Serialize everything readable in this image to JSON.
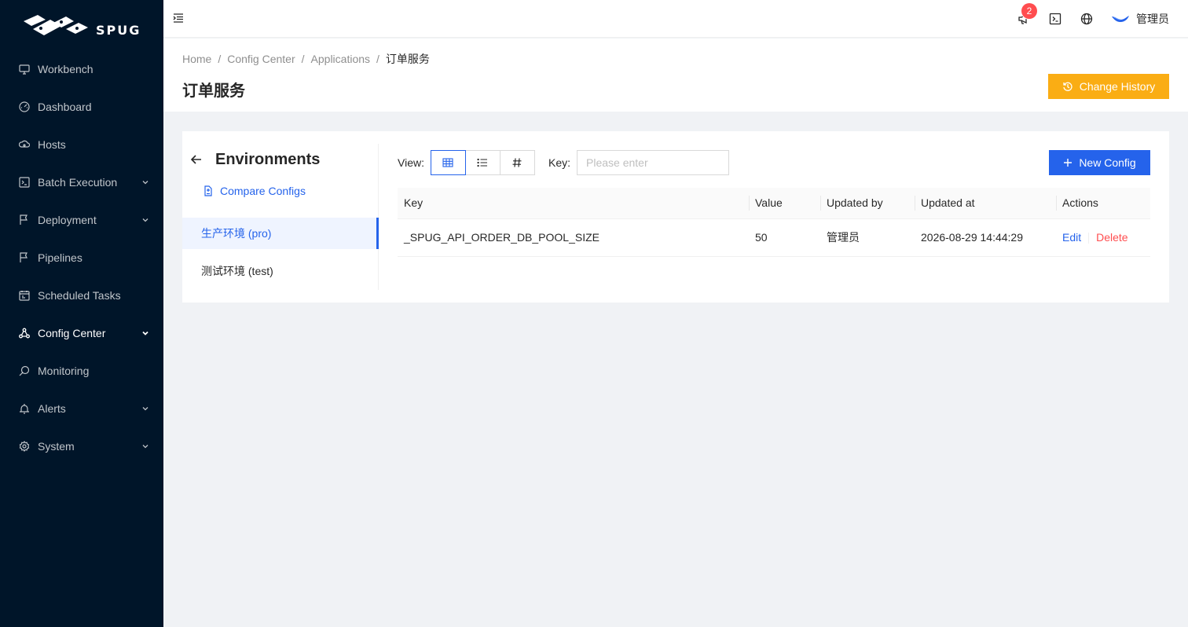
{
  "app": {
    "logo_text": "SPUG"
  },
  "sidebar": {
    "items": [
      {
        "label": "Workbench",
        "icon": "desktop-icon",
        "has_children": false
      },
      {
        "label": "Dashboard",
        "icon": "dashboard-icon",
        "has_children": false
      },
      {
        "label": "Hosts",
        "icon": "cloud-server-icon",
        "has_children": false
      },
      {
        "label": "Batch Execution",
        "icon": "code-icon",
        "has_children": true
      },
      {
        "label": "Deployment",
        "icon": "flag-icon",
        "has_children": true
      },
      {
        "label": "Pipelines",
        "icon": "flag-icon",
        "has_children": false
      },
      {
        "label": "Scheduled Tasks",
        "icon": "schedule-icon",
        "has_children": false
      },
      {
        "label": "Config Center",
        "icon": "deployment-unit-icon",
        "has_children": true,
        "active": true
      },
      {
        "label": "Monitoring",
        "icon": "monitor-icon",
        "has_children": false
      },
      {
        "label": "Alerts",
        "icon": "alarm-icon",
        "has_children": true
      },
      {
        "label": "System",
        "icon": "setting-icon",
        "has_children": true
      }
    ]
  },
  "header": {
    "notification_count": "2",
    "user_name": "管理员"
  },
  "breadcrumb": [
    "Home",
    "Config Center",
    "Applications",
    "订单服务"
  ],
  "page": {
    "title": "订单服务",
    "history_button": "Change History"
  },
  "env_panel": {
    "title": "Environments",
    "compare_link": "Compare Configs",
    "environments": [
      {
        "label": "生产环境 (pro)",
        "active": true
      },
      {
        "label": "测试环境 (test)",
        "active": false
      }
    ]
  },
  "toolbar": {
    "view_label": "View",
    "key_label": "Key",
    "key_placeholder": "Please enter",
    "new_button": "New Config"
  },
  "table": {
    "headers": [
      "Key",
      "Value",
      "Updated by",
      "Updated at",
      "Actions"
    ],
    "rows": [
      {
        "key": "_SPUG_API_ORDER_DB_POOL_SIZE",
        "value": "50",
        "updated_by": "管理员",
        "updated_at": "2026-08-29 14:44:29",
        "edit": "Edit",
        "delete": "Delete"
      }
    ]
  },
  "colors": {
    "sidebar_bg": "#001529",
    "primary": "#2563eb",
    "warning": "#faad14",
    "danger": "#ff4d4f"
  }
}
